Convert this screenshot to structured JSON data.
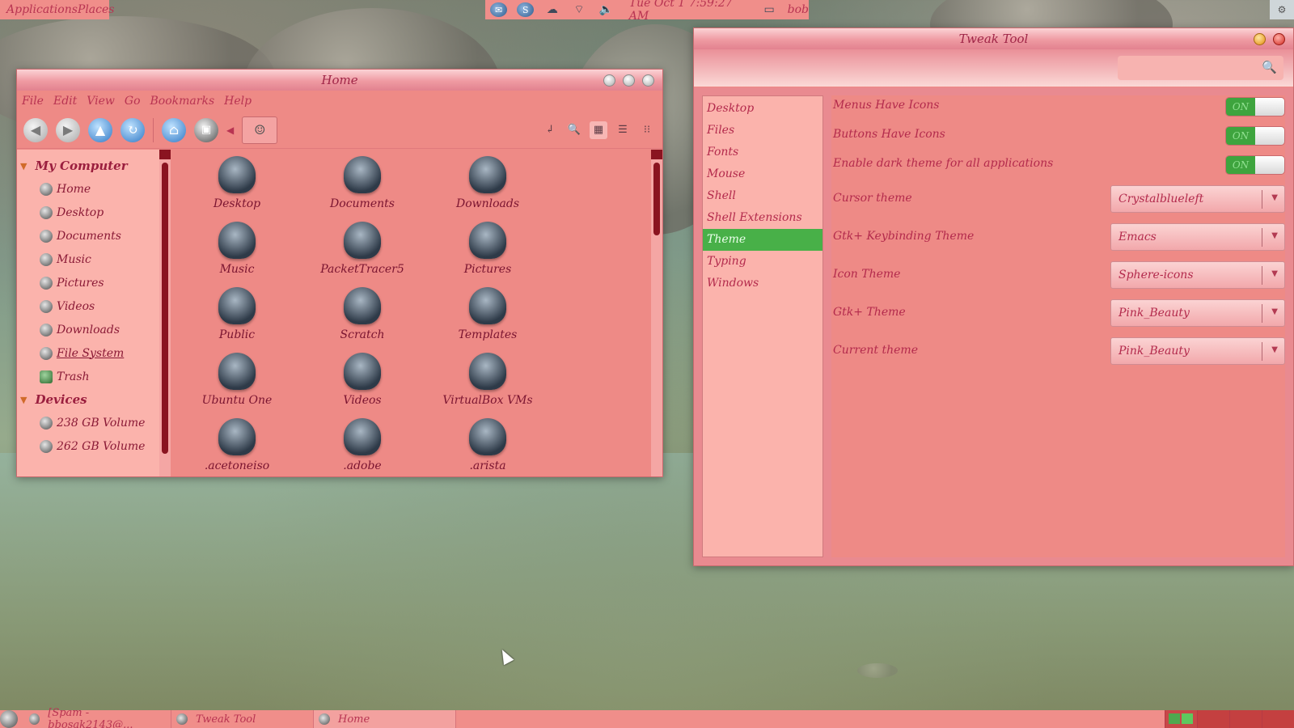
{
  "top_panel": {
    "menu_label": "ApplicationsPlaces",
    "clock": "Tue Oct  1   7:59:27 AM",
    "user": "bob"
  },
  "home_window": {
    "title": "Home",
    "menu": [
      "File",
      "Edit",
      "View",
      "Go",
      "Bookmarks",
      "Help"
    ],
    "sidebar": {
      "sections": [
        {
          "title": "My Computer",
          "items": [
            "Home",
            "Desktop",
            "Documents",
            "Music",
            "Pictures",
            "Videos",
            "Downloads",
            "File System",
            "Trash"
          ]
        },
        {
          "title": "Devices",
          "items": [
            "238 GB Volume",
            "262 GB Volume"
          ]
        }
      ]
    },
    "files": [
      "Desktop",
      "Documents",
      "Downloads",
      "Music",
      "PacketTracer5",
      "Pictures",
      "Public",
      "Scratch",
      "Templates",
      "Ubuntu One",
      "Videos",
      "VirtualBox VMs",
      ".acetoneiso",
      ".adobe",
      ".arista"
    ]
  },
  "tweak_window": {
    "title": "Tweak Tool",
    "categories": [
      "Desktop",
      "Files",
      "Fonts",
      "Mouse",
      "Shell",
      "Shell Extensions",
      "Theme",
      "Typing",
      "Windows"
    ],
    "selected_category": "Theme",
    "switches": [
      {
        "label": "Menus Have Icons",
        "state": "ON"
      },
      {
        "label": "Buttons Have Icons",
        "state": "ON"
      },
      {
        "label": "Enable dark theme for all applications",
        "state": "ON"
      }
    ],
    "dropdowns": [
      {
        "label": "Cursor theme",
        "value": "Crystalblueleft"
      },
      {
        "label": "Gtk+ Keybinding Theme",
        "value": "Emacs"
      },
      {
        "label": "Icon Theme",
        "value": "Sphere-icons"
      },
      {
        "label": "Gtk+ Theme",
        "value": "Pink_Beauty"
      },
      {
        "label": "Current theme",
        "value": "Pink_Beauty"
      }
    ]
  },
  "taskbar": {
    "tasks": [
      "[Spam - bbosak2143@...",
      "Tweak Tool",
      "Home"
    ]
  },
  "colors": {
    "theme_pink": "#ee8a86",
    "accent_text": "#b32a4c",
    "selected_green": "#48b048"
  }
}
